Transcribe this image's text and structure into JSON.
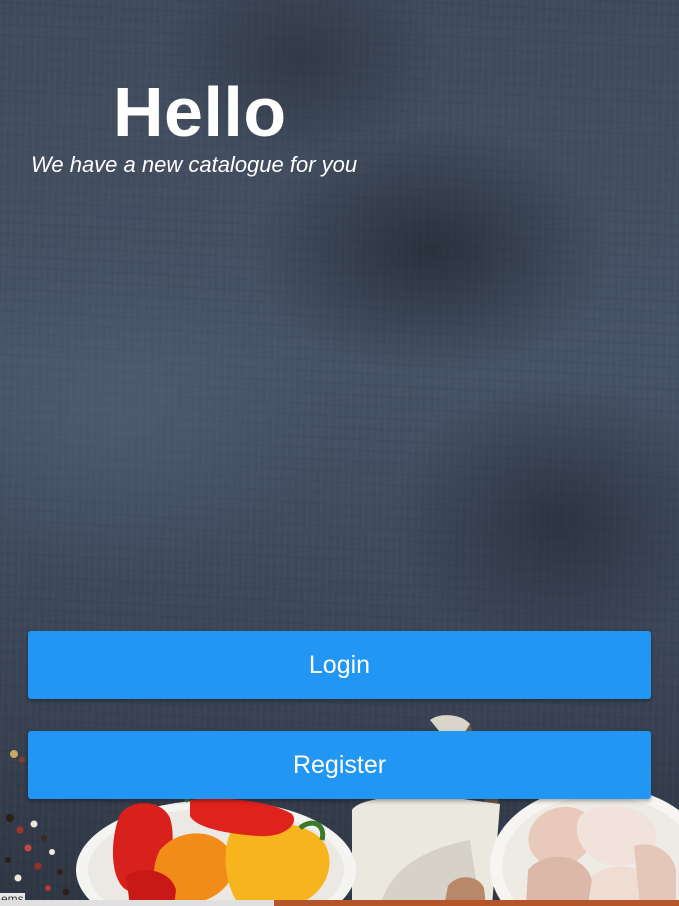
{
  "header": {
    "title": "Hello",
    "subtitle": "We have a new catalogue for you"
  },
  "actions": {
    "login_label": "Login",
    "register_label": "Register"
  },
  "footer": {
    "text": "ems"
  },
  "colors": {
    "button_background": "#2196f3",
    "button_text": "#ffffff",
    "background": "#3b4656"
  },
  "images": {
    "food": "vegetables-and-garlic-bowls"
  }
}
